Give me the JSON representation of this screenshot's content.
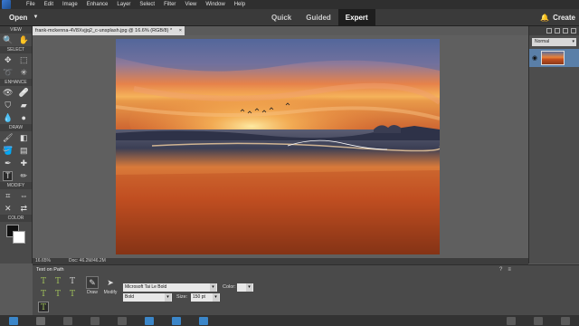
{
  "menubar": {
    "items": [
      "File",
      "Edit",
      "Image",
      "Enhance",
      "Layer",
      "Select",
      "Filter",
      "View",
      "Window",
      "Help"
    ]
  },
  "topbar": {
    "open_label": "Open",
    "modes": [
      "Quick",
      "Guided",
      "Expert"
    ],
    "active_mode": "Expert",
    "create_label": "Create"
  },
  "toolpanel": {
    "sections": [
      "VIEW",
      "SELECT",
      "ENHANCE",
      "DRAW",
      "MODIFY",
      "COLOR"
    ]
  },
  "document": {
    "tab_title": "frank-mckenna-4V8Xvjjq2_c-unsplash.jpg @ 16.6% (RGB/8) *",
    "close_glyph": "×"
  },
  "status": {
    "zoom": "16.65%",
    "doc_size": "Doc: 46.2M/46.2M"
  },
  "layers": {
    "blend_mode": "Normal"
  },
  "options": {
    "title": "Text on Path",
    "draw_label": "Draw",
    "modify_label": "Modify",
    "font_family": "Microsoft Tai Le Bold",
    "font_style": "Bold",
    "size_label": "Size:",
    "size_value": "150 pt",
    "color_label": "Color:"
  },
  "colors": {
    "accent": "#4a9ff5",
    "active_mode_bg": "#1e1e1e",
    "layer_selected": "#5a7fa8"
  }
}
